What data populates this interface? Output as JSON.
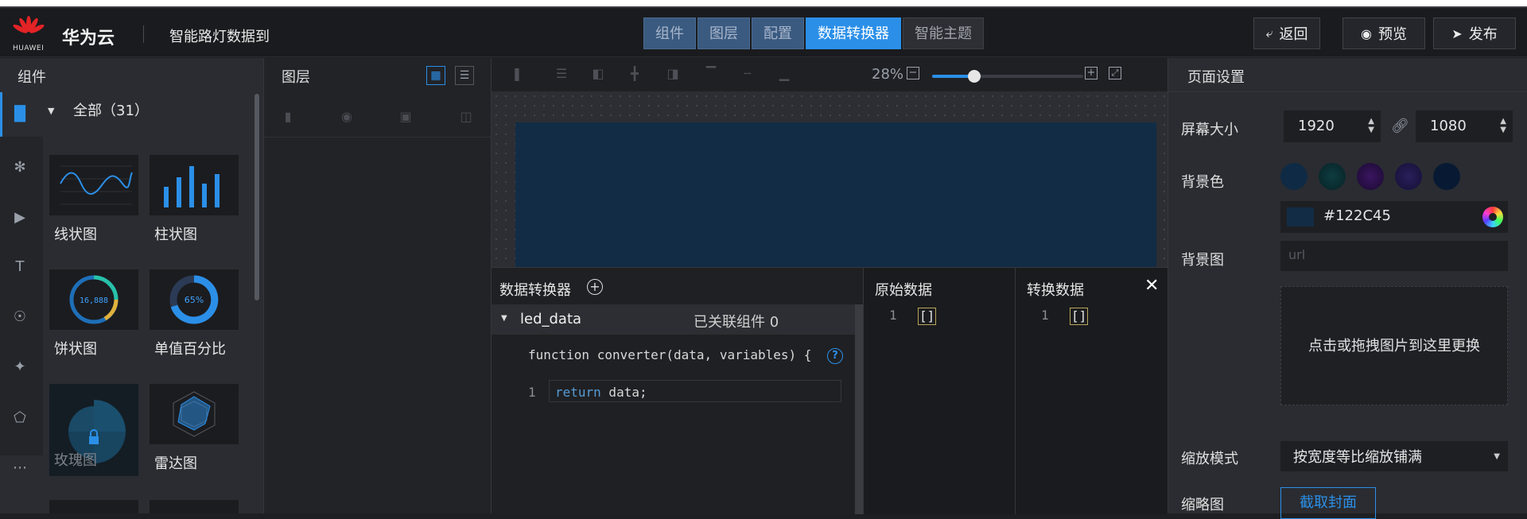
{
  "header": {
    "logo_text": "HUAWEI",
    "brand": "华为云",
    "project_name": "智能路灯数据到",
    "tabs": [
      "组件",
      "图层",
      "配置",
      "数据转换器",
      "智能主题"
    ],
    "active_tab": "数据转换器",
    "buttons": {
      "back": "返回",
      "preview": "预览",
      "publish": "发布"
    }
  },
  "components_panel": {
    "title": "组件",
    "category": "全部（31）",
    "items": [
      "线状图",
      "柱状图",
      "饼状图",
      "单值百分比",
      "玫瑰图",
      "雷达图"
    ],
    "pie_value": "16,888",
    "percent_value": "65%"
  },
  "layers_panel": {
    "title": "图层"
  },
  "canvas": {
    "zoom": "28%",
    "zoom_level": 0.28
  },
  "converter": {
    "title": "数据转换器",
    "function_name": "led_data",
    "linked": "已关联组件 0",
    "code_signature": "function converter(data, variables) {",
    "help": "?",
    "line_no": "1",
    "return_kw": "return",
    "return_rest": " data;",
    "raw": {
      "title": "原始数据",
      "line": "1",
      "value": "[]"
    },
    "transformed": {
      "title": "转换数据",
      "line": "1",
      "value": "[]"
    }
  },
  "page_settings": {
    "title": "页面设置",
    "screen_size_label": "屏幕大小",
    "width": "1920",
    "height": "1080",
    "bg_color_label": "背景色",
    "swatches": [
      "#0f2a44",
      "#0a3236",
      "#2a0f44",
      "#1e1a4a",
      "#081a33"
    ],
    "bg_color": "#122C45",
    "bg_image_label": "背景图",
    "bg_image_placeholder": "url",
    "upload_hint": "点击或拖拽图片到这里更换",
    "scale_mode_label": "缩放模式",
    "scale_mode": "按宽度等比缩放铺满",
    "thumbnail_label": "缩略图",
    "capture_button": "截取封面"
  }
}
